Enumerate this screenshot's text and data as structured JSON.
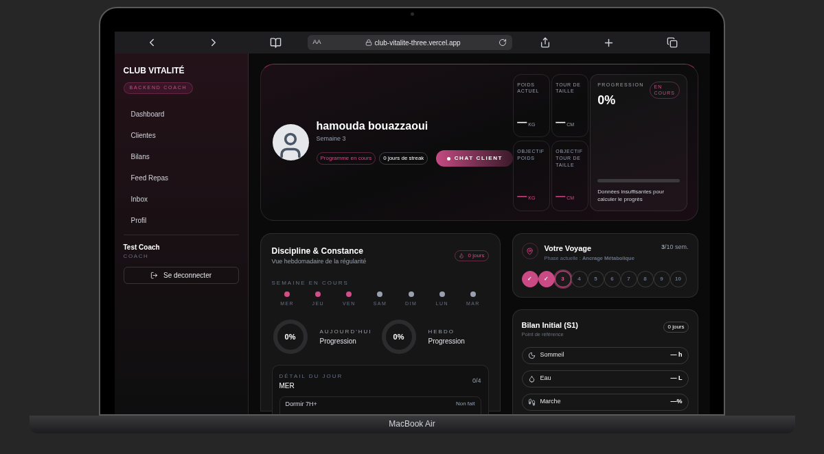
{
  "browser": {
    "text_size": "AA",
    "address": "club-vitalite-three.vercel.app"
  },
  "sidebar": {
    "brand": "CLUB VITALITÉ",
    "badge": "BACKEND COACH",
    "items": [
      {
        "label": "Dashboard",
        "selected": false
      },
      {
        "label": "Clientes",
        "selected": false
      },
      {
        "label": "Bilans",
        "selected": false
      },
      {
        "label": "Feed Repas",
        "selected": false
      },
      {
        "label": "Inbox",
        "selected": false
      },
      {
        "label": "Profil",
        "selected": false
      }
    ],
    "user": {
      "name": "Test Coach",
      "role": "COACH"
    },
    "logout": "Se deconnecter"
  },
  "hero": {
    "name": "hamouda bouazzaoui",
    "week": "Semaine 3",
    "status_tag": "Programme en cours",
    "streak_tag": "0 jours de streak",
    "chat_button": "CHAT CLIENT",
    "stats": [
      {
        "label": "POIDS ACTUEL",
        "value": "—",
        "unit": "KG",
        "kind": "current"
      },
      {
        "label": "TOUR DE TAILLE",
        "value": "—",
        "unit": "CM",
        "kind": "current"
      },
      {
        "label": "OBJECTIF POIDS",
        "value": "—",
        "unit": "KG",
        "kind": "goal"
      },
      {
        "label": "OBJECTIF TOUR DE TAILLE",
        "value": "—",
        "unit": "CM",
        "kind": "goal"
      }
    ],
    "progression": {
      "label": "PROGRESSION",
      "value": "0%",
      "badge": "EN COURS",
      "level": 0,
      "note": "Données insuffisantes pour calculer le progrès"
    }
  },
  "discipline": {
    "title": "Discipline & Constance",
    "subtitle": "Vue hebdomadaire de la régularité",
    "streak": "0 jours",
    "week_label": "SEMAINE EN COURS",
    "days": [
      {
        "label": "MER",
        "done": true
      },
      {
        "label": "JEU",
        "done": true
      },
      {
        "label": "VEN",
        "done": true
      },
      {
        "label": "SAM",
        "done": false
      },
      {
        "label": "DIM",
        "done": false
      },
      {
        "label": "LUN",
        "done": false
      },
      {
        "label": "MAR",
        "done": false
      }
    ],
    "rings": [
      {
        "value": "0%",
        "label": "AUJOURD'HUI",
        "caption": "Progression"
      },
      {
        "value": "0%",
        "label": "HEBDO",
        "caption": "Progression"
      }
    ],
    "detail": {
      "label": "DÉTAIL DU JOUR",
      "day": "MER",
      "count": "0/4",
      "tasks": [
        {
          "name": "Dormir 7H+",
          "status": "Non fait"
        }
      ]
    }
  },
  "journey": {
    "title": "Votre Voyage",
    "phase": "Phase actuelle : **Ancrage Métabolique**",
    "weeks": "**3**/10 sem.",
    "steps": [
      {
        "label": "✓",
        "kind": "done"
      },
      {
        "label": "✓",
        "kind": "done"
      },
      {
        "label": "3",
        "kind": "current"
      },
      {
        "label": "4",
        "kind": "upcoming"
      },
      {
        "label": "5",
        "kind": "upcoming"
      },
      {
        "label": "6",
        "kind": "upcoming"
      },
      {
        "label": "7",
        "kind": "upcoming"
      },
      {
        "label": "8",
        "kind": "upcoming"
      },
      {
        "label": "9",
        "kind": "upcoming"
      },
      {
        "label": "10",
        "kind": "upcoming"
      }
    ]
  },
  "bilan": {
    "title": "Bilan Initial (S1)",
    "subtitle": "Point de référence",
    "badge": "0 jours",
    "rows": [
      {
        "kind": "sleep",
        "label": "Sommeil",
        "value": "— h"
      },
      {
        "kind": "water",
        "label": "Eau",
        "value": "— L"
      },
      {
        "kind": "walk",
        "label": "Marche",
        "value": "—%"
      }
    ]
  },
  "device": {
    "label": "MacBook Air"
  }
}
